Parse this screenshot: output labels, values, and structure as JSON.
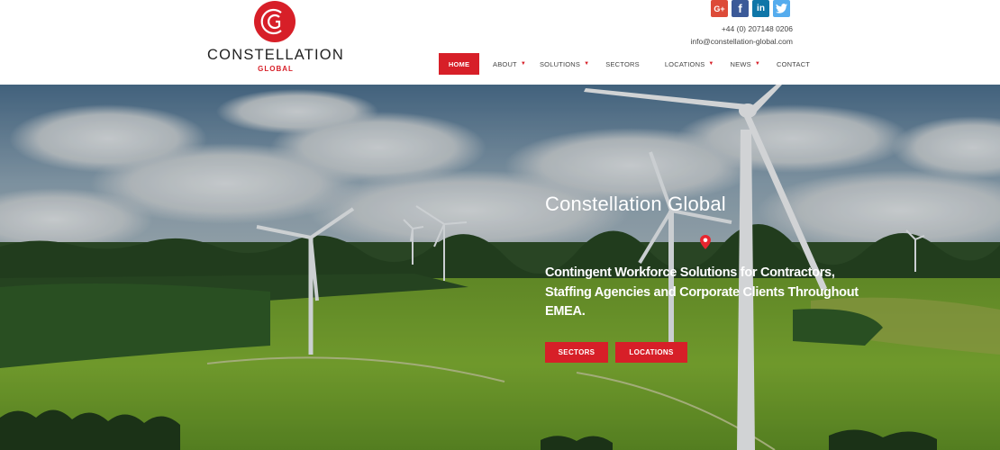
{
  "brand": {
    "logo_letters": "CG",
    "name": "CONSTELLATION",
    "sub": "GLOBAL",
    "color": "#d71f28"
  },
  "social": [
    {
      "name": "google-plus",
      "glyph": "G+",
      "color": "#dd4b39"
    },
    {
      "name": "facebook",
      "glyph": "f",
      "color": "#3b5998"
    },
    {
      "name": "linkedin",
      "glyph": "in",
      "color": "#0e76a8"
    },
    {
      "name": "twitter",
      "glyph": "t",
      "color": "#55acee"
    }
  ],
  "contact": {
    "phone": "+44 (0) 207148 0206",
    "email": "info@constellation-global.com"
  },
  "nav": {
    "home": "HOME",
    "about": "ABOUT",
    "solutions": "SOLUTIONS",
    "sectors": "SECTORS",
    "locations": "LOCATIONS",
    "news": "NEWS",
    "contact": "CONTACT",
    "caret": "▼"
  },
  "hero": {
    "title": "Constellation Global",
    "text": "Contingent Workforce Solutions for Contractors, Staffing Agencies and Corporate Clients Throughout EMEA.",
    "btn_sectors": "SECTORS",
    "btn_locations": "LOCATIONS"
  }
}
